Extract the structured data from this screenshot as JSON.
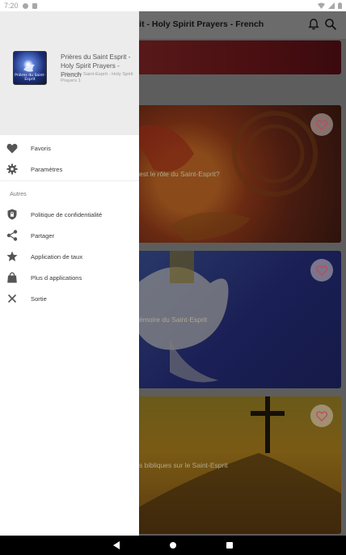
{
  "status_bar": {
    "time": "7:20",
    "icons": [
      "location-icon",
      "sd-card-icon",
      "wifi-icon",
      "signal-icon",
      "battery-icon"
    ]
  },
  "app_bar": {
    "title": "esprit - Holy Spirit Prayers - French",
    "actions": [
      "bell-icon",
      "search-icon"
    ]
  },
  "cards": [
    {
      "label": "",
      "favorite": false
    },
    {
      "label": "est le rôle du Saint-Esprit?",
      "favorite": true
    },
    {
      "label": "émoire du Saint-Esprit",
      "favorite": true
    },
    {
      "label": "s bibliques sur le Saint-Esprit",
      "favorite": true
    }
  ],
  "drawer": {
    "logo_text": "Prières du Saint-Esprit",
    "title": "Prières du Saint Esprit - Holy Spirit Prayers - French",
    "subtitle": "Prières du Saint-Esprit - Holy Spirit Prayers 1",
    "items": [
      {
        "label": "Favoris",
        "icon": "heart-icon"
      },
      {
        "label": "Paramètres",
        "icon": "gear-icon"
      }
    ],
    "section": "Autres",
    "other_items": [
      {
        "label": "Politique de confidentialité",
        "icon": "shield-lock-icon"
      },
      {
        "label": "Partager",
        "icon": "share-icon"
      },
      {
        "label": "Application de taux",
        "icon": "star-icon"
      },
      {
        "label": "Plus d applications",
        "icon": "shopping-bag-icon"
      },
      {
        "label": "Sortie",
        "icon": "close-icon"
      }
    ]
  },
  "colors": {
    "accent": "#c04a5a",
    "drawer_header": "#ececec",
    "scrim": "#5b5b5b"
  }
}
